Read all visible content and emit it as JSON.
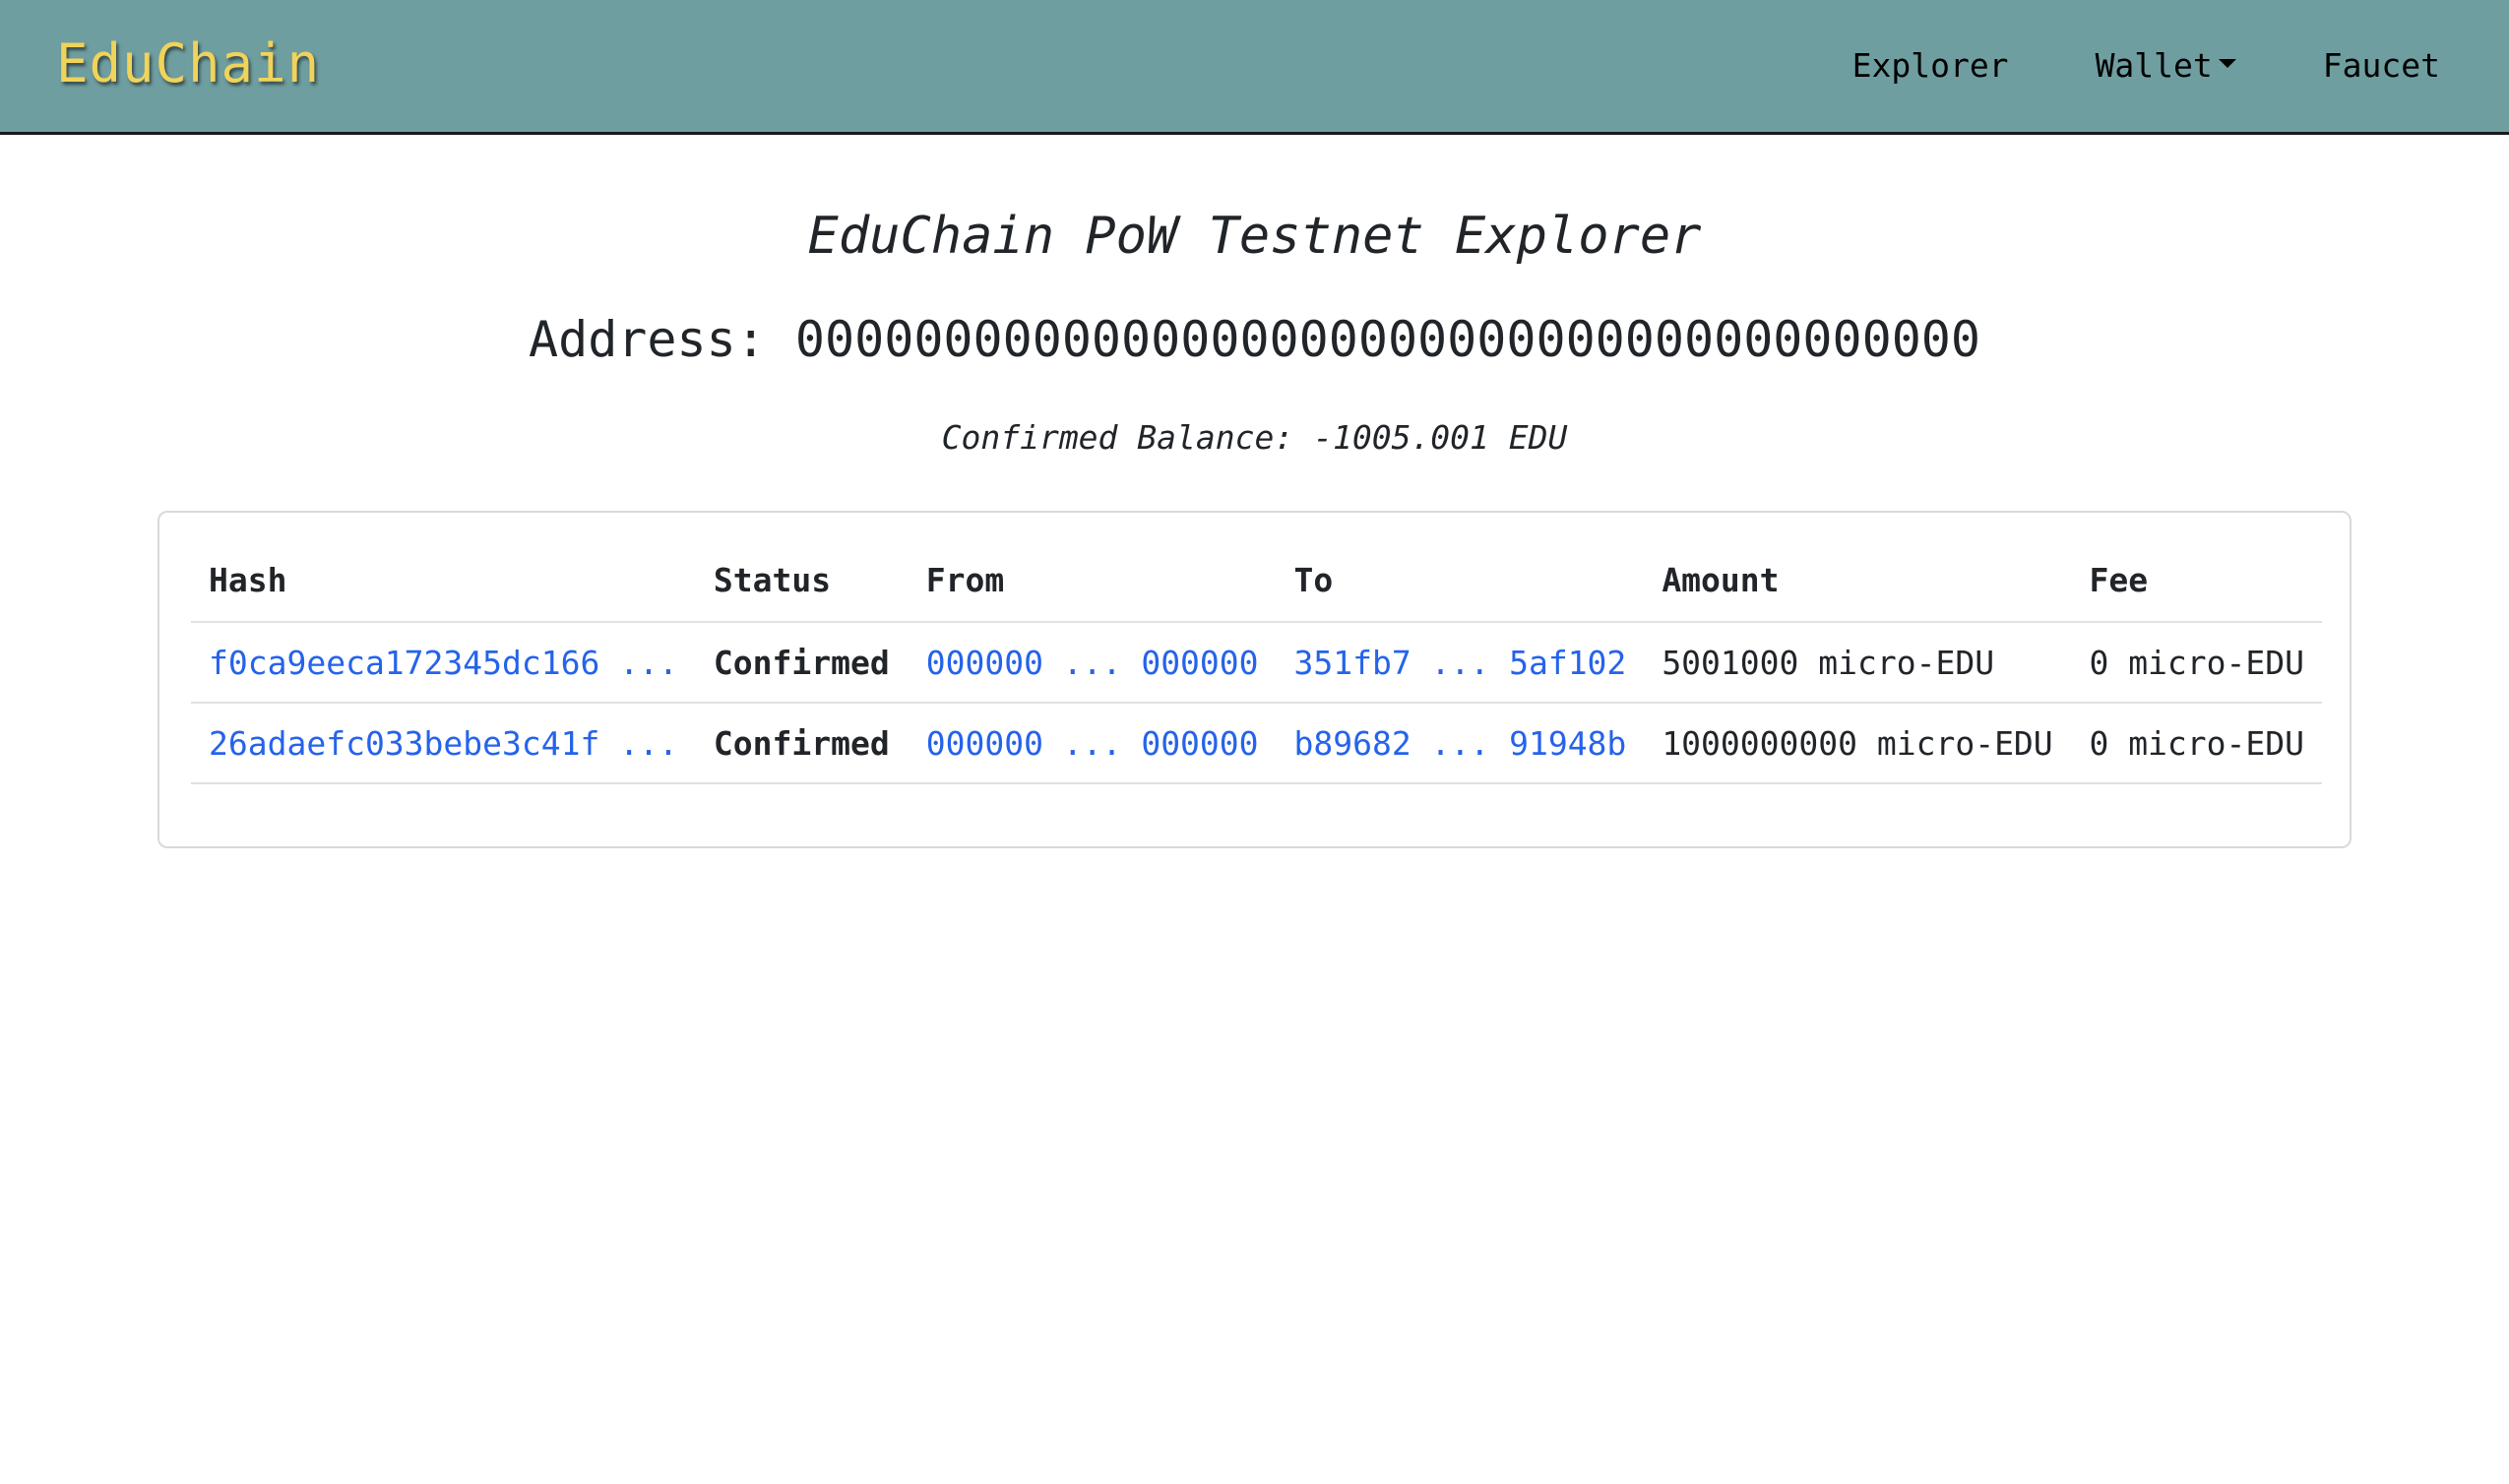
{
  "navbar": {
    "brand": "EduChain",
    "links": {
      "explorer": "Explorer",
      "wallet": "Wallet",
      "faucet": "Faucet"
    },
    "background_color": "#6f9ea0",
    "brand_color": "#f0d35a"
  },
  "page": {
    "title": "EduChain PoW Testnet Explorer",
    "address_line": "Address: 0000000000000000000000000000000000000000",
    "balance_line": "Confirmed Balance: -1005.001 EDU"
  },
  "table": {
    "headers": {
      "hash": "Hash",
      "status": "Status",
      "from": "From",
      "to": "To",
      "amount": "Amount",
      "fee": "Fee"
    },
    "rows": [
      {
        "hash": "f0ca9eeca172345dc166 ...",
        "status": "Confirmed",
        "from": "000000 ... 000000",
        "to": "351fb7 ... 5af102",
        "amount": "5001000 micro-EDU",
        "fee": "0 micro-EDU"
      },
      {
        "hash": "26adaefc033bebe3c41f ...",
        "status": "Confirmed",
        "from": "000000 ... 000000",
        "to": "b89682 ... 91948b",
        "amount": "1000000000 micro-EDU",
        "fee": "0 micro-EDU"
      }
    ],
    "link_color": "#2563eb"
  }
}
